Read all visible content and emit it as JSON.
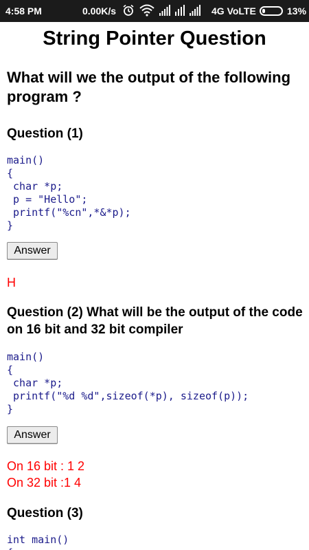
{
  "status_bar": {
    "time": "4:58 PM",
    "speed": "0.00K/s",
    "network": "4G VoLTE",
    "battery": "13%",
    "battery_level": 0.13,
    "icons": [
      "alarm-icon",
      "wifi-icon",
      "signal-icon",
      "signal-icon",
      "signal-icon"
    ]
  },
  "page": {
    "title": "String Pointer Question",
    "intro": "What will we the output of the following program ?"
  },
  "questions": [
    {
      "heading": "Question (1)",
      "code": "main()\n{\n char *p;\n p = \"Hello\";\n printf(\"%cn\",*&*p);\n}",
      "button_label": "Answer",
      "answer_lines": [
        "H"
      ]
    },
    {
      "heading": "Question (2) What will be the output of the code on 16 bit and 32 bit compiler",
      "code": "main()\n{\n char *p;\n printf(\"%d %d\",sizeof(*p), sizeof(p));\n}",
      "button_label": "Answer",
      "answer_lines": [
        "On 16 bit : 1 2",
        "On 32 bit :1 4"
      ]
    },
    {
      "heading": "Question (3)",
      "code": "int main()\n{"
    }
  ]
}
